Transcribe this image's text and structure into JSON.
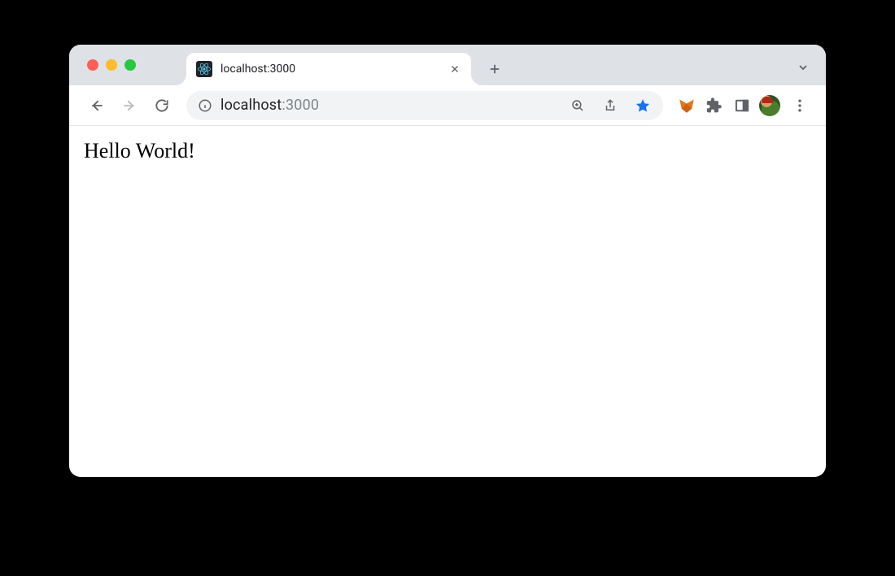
{
  "tab": {
    "title": "localhost:3000",
    "favicon": "react-icon"
  },
  "url": {
    "host": "localhost",
    "path": ":3000"
  },
  "page": {
    "body_text": "Hello World!"
  },
  "icons": {
    "back": "arrow-left-icon",
    "forward": "arrow-right-icon",
    "reload": "reload-icon",
    "site_info": "info-icon",
    "zoom": "zoom-icon",
    "share": "share-icon",
    "bookmark": "star-icon",
    "ext_metamask": "metamask-icon",
    "extensions": "puzzle-icon",
    "side_panel": "side-panel-icon",
    "profile": "avatar-icon",
    "menu": "kebab-menu-icon",
    "new_tab": "plus-icon",
    "tab_list": "chevron-down-icon",
    "close_tab": "close-icon"
  },
  "colors": {
    "tabstrip_bg": "#dee1e6",
    "omnibox_bg": "#f1f3f4",
    "bookmark_active": "#1a73e8"
  }
}
